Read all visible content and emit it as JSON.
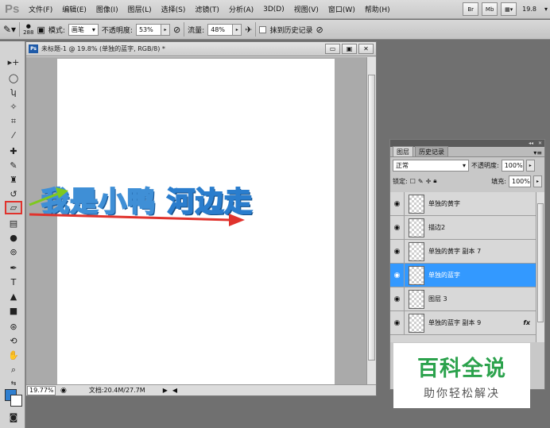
{
  "app": {
    "logo": "Ps"
  },
  "menu": [
    "文件(F)",
    "编辑(E)",
    "图像(I)",
    "图层(L)",
    "选择(S)",
    "滤镜(T)",
    "分析(A)",
    "3D(D)",
    "视图(V)",
    "窗口(W)",
    "帮助(H)"
  ],
  "menu_right": {
    "br": "Br",
    "mb": "Mb",
    "zoom": "19.8",
    "arrange": "▾"
  },
  "options": {
    "brush_size": "288",
    "mode_label": "模式:",
    "mode_value": "画笔",
    "opacity_label": "不透明度:",
    "opacity_value": "53%",
    "flow_label": "流量:",
    "flow_value": "48%",
    "history_label": "抹到历史记录"
  },
  "document": {
    "title": "未标题-1 @ 19.8% (单独的蓝字, RGB/8) *",
    "badge": "Ps",
    "zoom": "19.77%",
    "doc_size": "文档:20.4M/27.7M",
    "art_yellow": "我是小鸭",
    "art_blue": "河边走"
  },
  "layers_panel": {
    "tabs": [
      "图层",
      "历史记录"
    ],
    "blend_mode": "正常",
    "opacity_label": "不透明度:",
    "opacity_value": "100%",
    "lock_label": "锁定:",
    "fill_label": "填充:",
    "fill_value": "100%",
    "layers": [
      {
        "name": "单独的黄字",
        "selected": false,
        "fx": ""
      },
      {
        "name": "描边2",
        "selected": false,
        "fx": ""
      },
      {
        "name": "单独的黄字 副本 7",
        "selected": false,
        "fx": ""
      },
      {
        "name": "单独的蓝字",
        "selected": true,
        "fx": ""
      },
      {
        "name": "图层 3",
        "selected": false,
        "fx": ""
      },
      {
        "name": "单独的蓝字 副本 9",
        "selected": false,
        "fx": "fx"
      }
    ]
  },
  "watermark": {
    "title": "百科全说",
    "subtitle": "助你轻松解决"
  },
  "colors": {
    "foreground": "#2f7fd0",
    "background": "#ffffff",
    "highlight": "#e0332d",
    "selection": "#3399ff"
  }
}
